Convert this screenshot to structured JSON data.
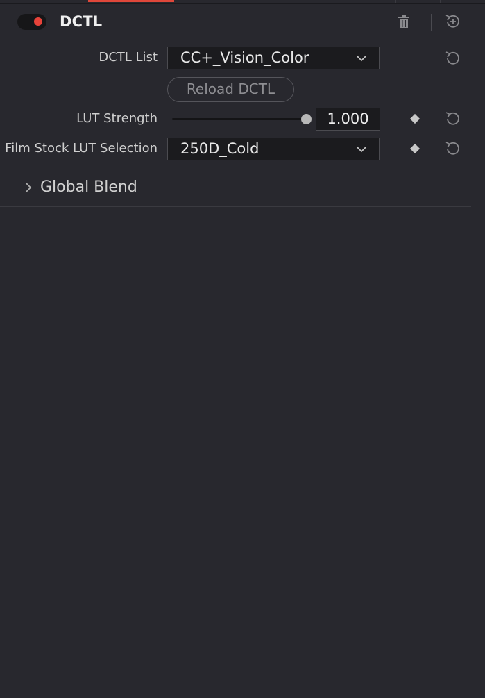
{
  "header": {
    "title": "DCTL",
    "enabled": true,
    "accent_color": "#e8433a"
  },
  "rows": {
    "dctl_list": {
      "label": "DCTL List",
      "value": "CC+_Vision_Color"
    },
    "reload": {
      "label": "Reload DCTL"
    },
    "lut_strength": {
      "label": "LUT Strength",
      "value": "1.000",
      "slider_fraction": 1.0
    },
    "film_stock": {
      "label": "Film Stock LUT Selection",
      "value": "250D_Cold"
    }
  },
  "sections": {
    "global_blend": {
      "title": "Global Blend",
      "expanded": false
    }
  },
  "icons": {
    "toggle": "toggle-switch",
    "delete": "trash-icon",
    "reset_all": "reset-plus-icon",
    "reset": "reset-icon",
    "keyframe": "diamond-keyframe-icon",
    "dropdown": "chevron-down-icon",
    "expand": "chevron-right-icon"
  }
}
